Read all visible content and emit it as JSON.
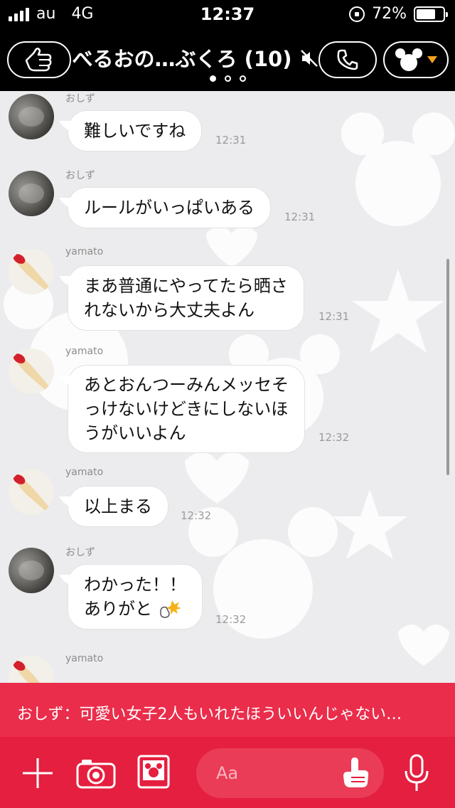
{
  "status_bar": {
    "carrier": "au",
    "network": "4G",
    "time": "12:37",
    "battery_percent": "72%",
    "battery_level": 0.72
  },
  "header": {
    "title": "べるおの…ぶくろ (10)",
    "page_count": 3,
    "active_page": 0,
    "menu_arrow_color": "#f3a11e"
  },
  "messages": [
    {
      "sender": "おしず",
      "avatar": "cat-photo",
      "lines": [
        "難しいですね"
      ],
      "time": "12:31"
    },
    {
      "sender": "おしず",
      "avatar": "cat-photo",
      "lines": [
        "ルールがいっぱいある"
      ],
      "time": "12:31"
    },
    {
      "sender": "yamato",
      "avatar": "finger-photo",
      "lines": [
        "まあ普通にやってたら晒さ",
        "れないから大丈夫よん"
      ],
      "time": "12:31"
    },
    {
      "sender": "yamato",
      "avatar": "finger-photo",
      "lines": [
        "あとおんつーみんメッセそ",
        "っけないけどきにしないほ",
        "うがいいよん"
      ],
      "time": "12:32"
    },
    {
      "sender": "yamato",
      "avatar": "finger-photo",
      "lines": [
        "以上まる"
      ],
      "time": "12:32"
    },
    {
      "sender": "おしず",
      "avatar": "cat-photo",
      "lines": [
        "わかった！！",
        "ありがと"
      ],
      "time": "12:32",
      "emoji": "pointing-hand-bang-emoji"
    },
    {
      "sender": "yamato",
      "avatar": "finger-photo",
      "lines": [],
      "time": ""
    }
  ],
  "notification": {
    "text": "おしず：可愛い女子2人もいれたほういいんじゃない…"
  },
  "input_bar": {
    "placeholder": "Aa"
  },
  "colors": {
    "header_bg": "#000000",
    "chat_bg": "#ececee",
    "notification_bg": "#ea2d4b",
    "input_bar_bg": "#e41f3f"
  }
}
